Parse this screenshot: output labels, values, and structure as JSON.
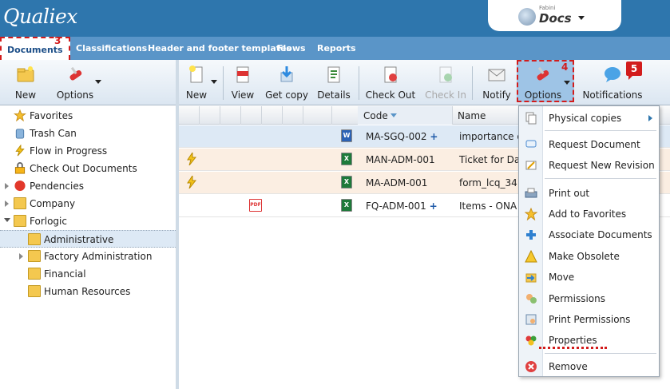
{
  "header": {
    "logo": "Qualiex",
    "app_small": "Fabini",
    "app_name": "Docs"
  },
  "tabs": [
    {
      "label": "Documents",
      "active": true
    },
    {
      "label": "Classifications"
    },
    {
      "label": "Header and footer templates"
    },
    {
      "label": "Flows"
    },
    {
      "label": "Reports"
    }
  ],
  "annotations": {
    "tab_badge": "3",
    "options_badge": "4",
    "notif_badge": "5"
  },
  "left_toolbar": {
    "new_label": "New",
    "options_label": "Options"
  },
  "right_toolbar": {
    "new_label": "New",
    "view_label": "View",
    "get_copy_label": "Get copy",
    "details_label": "Details",
    "check_out_label": "Check Out",
    "check_in_label": "Check In",
    "notify_label": "Notify",
    "options_label": "Options",
    "notifications_label": "Notifications"
  },
  "tree": [
    {
      "label": "Favorites",
      "icon": "star-icon"
    },
    {
      "label": "Trash Can",
      "icon": "trash-icon"
    },
    {
      "label": "Flow in Progress",
      "icon": "flow-icon"
    },
    {
      "label": "Check Out Documents",
      "icon": "lock-icon"
    },
    {
      "label": "Pendencies",
      "icon": "pendency-icon"
    },
    {
      "label": "Company",
      "icon": "folder-icon"
    },
    {
      "label": "Forlogic",
      "icon": "folder-icon"
    },
    {
      "label": "Administrative",
      "icon": "folder-icon"
    },
    {
      "label": "Factory Administration",
      "icon": "folder-icon"
    },
    {
      "label": "Financial",
      "icon": "folder-icon"
    },
    {
      "label": "Human Resources",
      "icon": "folder-icon"
    }
  ],
  "grid": {
    "columns": {
      "code": "Code",
      "name": "Name"
    },
    "rows": [
      {
        "code": "MA-SGQ-002",
        "plus": "+",
        "name": "importance of",
        "type": "word"
      },
      {
        "code": "MAN-ADM-001",
        "plus": "",
        "name": "Ticket for Das",
        "type": "excel"
      },
      {
        "code": "MA-ADM-001",
        "plus": "",
        "name": "form_lcq_34",
        "type": "excel"
      },
      {
        "code": "FQ-ADM-001",
        "plus": "+",
        "name": "Items - ONA",
        "type": "excel"
      }
    ],
    "pdf_label": "PDF"
  },
  "menu": [
    {
      "label": "Physical copies",
      "icon": "copies-icon"
    },
    {
      "label": "Request Document",
      "icon": "request-icon"
    },
    {
      "label": "Request New Revision",
      "icon": "revision-icon"
    },
    {
      "label": "Print out",
      "icon": "printer-icon"
    },
    {
      "label": "Add to Favorites",
      "icon": "star-icon"
    },
    {
      "label": "Associate Documents",
      "icon": "plus-icon"
    },
    {
      "label": "Make Obsolete",
      "icon": "warning-icon"
    },
    {
      "label": "Move",
      "icon": "move-icon"
    },
    {
      "label": "Permissions",
      "icon": "permissions-icon"
    },
    {
      "label": "Print Permissions",
      "icon": "print-permissions-icon"
    },
    {
      "label": "Properties",
      "icon": "properties-icon"
    },
    {
      "label": "Remove",
      "icon": "remove-icon"
    }
  ],
  "colors": {
    "header": "#2e76ad",
    "tabs": "#5a95c8",
    "annotation": "#d21c1c",
    "selection": "#dde9f5"
  }
}
